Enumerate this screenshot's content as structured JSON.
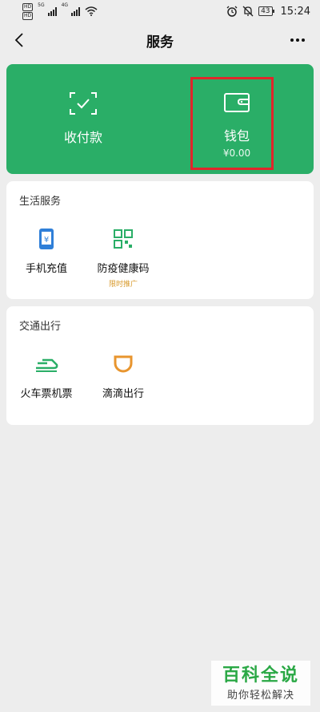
{
  "status_bar": {
    "sim1": "HD",
    "sim2": "HD",
    "net1": "5G",
    "net2": "4G",
    "battery": "43",
    "time": "15:24"
  },
  "nav": {
    "title": "服务"
  },
  "pay_card": {
    "receive_label": "收付款",
    "wallet_label": "钱包",
    "wallet_amount": "¥0.00",
    "color": "#2aae67"
  },
  "life_services": {
    "title": "生活服务",
    "items": [
      {
        "label": "手机充值",
        "sub": "",
        "icon": "phone-recharge-icon"
      },
      {
        "label": "防疫健康码",
        "sub": "限时推广",
        "icon": "qr-code-icon"
      }
    ]
  },
  "transport": {
    "title": "交通出行",
    "items": [
      {
        "label": "火车票机票",
        "sub": "",
        "icon": "train-icon"
      },
      {
        "label": "滴滴出行",
        "sub": "",
        "icon": "didi-icon"
      }
    ]
  },
  "watermark": {
    "title": "百科全说",
    "subtitle": "助你轻松解决"
  }
}
